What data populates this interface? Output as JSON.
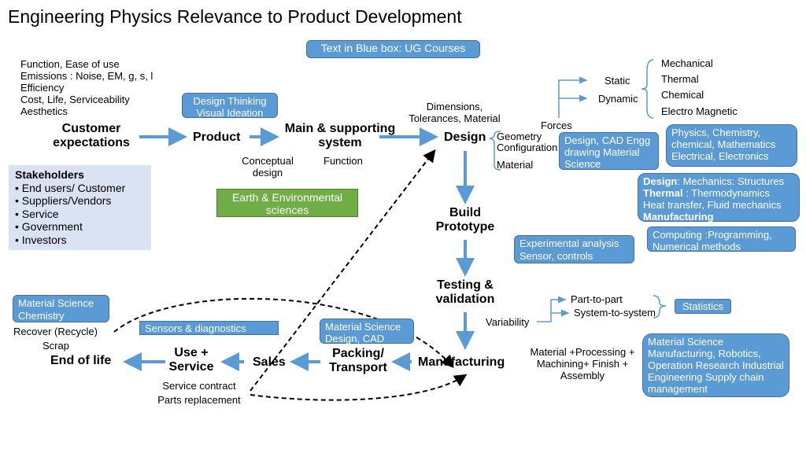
{
  "title": "Engineering Physics Relevance to Product Development",
  "legend": "Text in Blue box: UG Courses",
  "customer_needs": [
    "Function, Ease of use",
    "Emissions : Noise, EM, g, s, l",
    "Efficiency",
    "Cost, Life, Serviceability",
    "Aesthetics"
  ],
  "nodes": {
    "customer": "Customer expectations",
    "product": "Product",
    "main": "Main & supporting system",
    "design": "Design",
    "build": "Build Prototype",
    "testing": "Testing & validation",
    "manufacturing": "Manufacturing",
    "packing": "Packing/ Transport",
    "sales": "Sales",
    "use": "Use + Service",
    "eol": "End of life"
  },
  "labels": {
    "conceptual": "Conceptual design",
    "function": "Function",
    "dimensions": "Dimensions, Tolerances, Material",
    "geometry": "Geometry",
    "configuration": "Configuration",
    "material": "Material",
    "forces": "Forces",
    "static": "Static",
    "dynamic": "Dynamic",
    "mechanical": "Mechanical",
    "thermal": "Thermal",
    "chemical": "Chemical",
    "em": "Electro Magnetic",
    "variability": "Variability",
    "part": "Part-to-part",
    "system": "System-to-system",
    "process": "Material +Processing + Machining+ Finish + Assembly",
    "service_contract": "Service contract",
    "parts_replacement": "Parts replacement",
    "recover": "Recover (Recycle)",
    "scrap": "Scrap"
  },
  "stakeholders": {
    "title": "Stakeholders",
    "items": [
      "End users/ Customer",
      "Suppliers/Vendors",
      "Service",
      "Government",
      "Investors"
    ]
  },
  "courses": {
    "design_thinking": "Design Thinking Visual Ideation",
    "earth": "Earth & Environmental sciences",
    "cad": "Design, CAD Engg drawing Material Science",
    "physics": "Physics, Chemistry, chemical, Mathematics Electrical, Electronics",
    "mech_b1": "Design",
    ":": "",
    "mech_t1": ": Mechanics: Structures",
    "mech_b2": "Thermal",
    "mech_t2": " : Thermodynamics",
    "mech_t3": "Heat transfer, Fluid mechanics",
    "mech_b4": "Manufacturing",
    "computing": "Computing :Programming, Numerical methods",
    "experimental": "Experimental analysis Sensor, controls",
    "statistics": "Statistics",
    "mfg": "Material Science Manufacturing, Robotics, Operation Research Industrial Engineering Supply chain management",
    "pack": "Material Science Design, CAD",
    "sensors": "Sensors & diagnostics",
    "eol": "Material Science Chemistry"
  },
  "colors": {
    "blue_box": "#5b9bd5",
    "green_box": "#70ad47",
    "stakeholder_box": "#dae3f3",
    "arrow": "#5b9bd5"
  }
}
